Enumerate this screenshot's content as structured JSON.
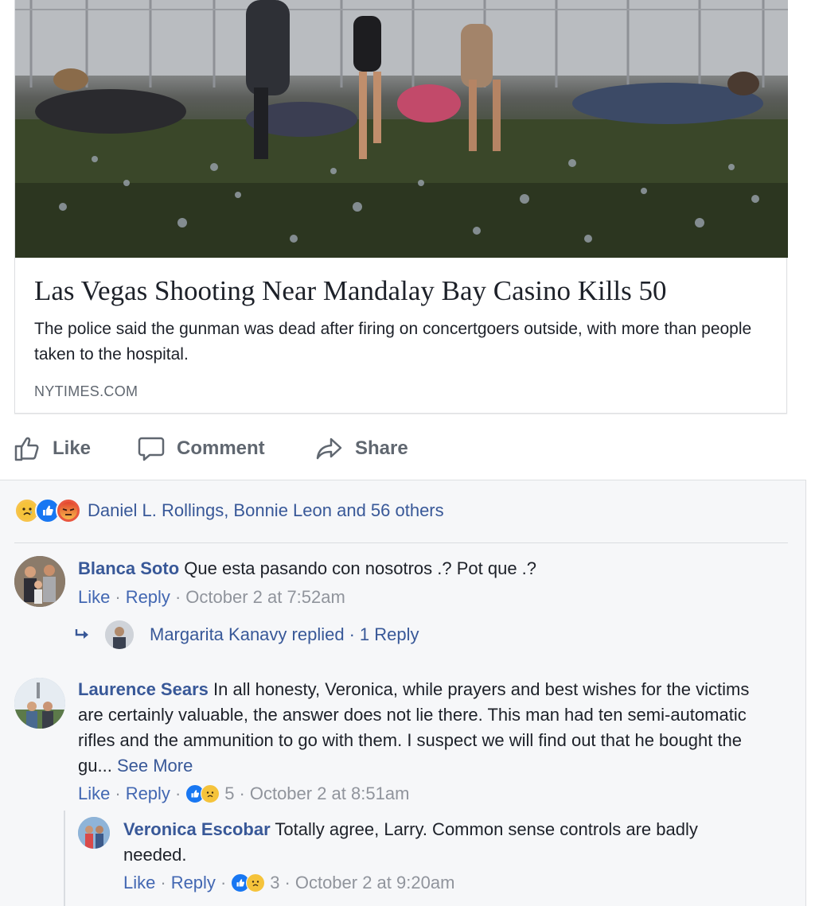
{
  "link_preview": {
    "title": "Las Vegas Shooting Near Mandalay Bay Casino Kills 50",
    "description": "The police said the gunman was dead after firing on concertgoers outside, with more than people taken to the hospital.",
    "source": "NYTIMES.COM"
  },
  "actions": {
    "like": "Like",
    "comment": "Comment",
    "share": "Share"
  },
  "reactions": {
    "names": "Daniel L. Rollings, Bonnie Leon and 56 others",
    "icons": [
      "sad-icon",
      "like-icon",
      "angry-icon"
    ]
  },
  "comments": [
    {
      "author": "Blanca Soto",
      "text": "Que esta pasando con nosotros .? Pot que .?",
      "like": "Like",
      "reply": "Reply",
      "time": "October 2 at 7:52am",
      "replies_summary": {
        "author": "Margarita Kanavy",
        "replied": "replied",
        "count": "1 Reply"
      }
    },
    {
      "author": "Laurence Sears",
      "text": "In all honesty, Veronica, while prayers and best wishes for the victims are certainly valuable, the answer does not lie there. This man had ten semi-automatic rifles and the ammunition to go with them. I suspect we will find out that he bought the gu...",
      "see_more": "See More",
      "like": "Like",
      "reply": "Reply",
      "reaction_count": "5",
      "time": "October 2 at 8:51am"
    },
    {
      "author": "Veronica Escobar",
      "text": "Totally agree, Larry. Common sense controls are badly needed.",
      "like": "Like",
      "reply": "Reply",
      "reaction_count": "3",
      "time": "October 2 at 9:20am"
    }
  ],
  "colors": {
    "link_blue": "#385898",
    "action_blue": "#4267b2",
    "meta_gray": "#90949c",
    "comment_bg": "#f6f7f9"
  }
}
